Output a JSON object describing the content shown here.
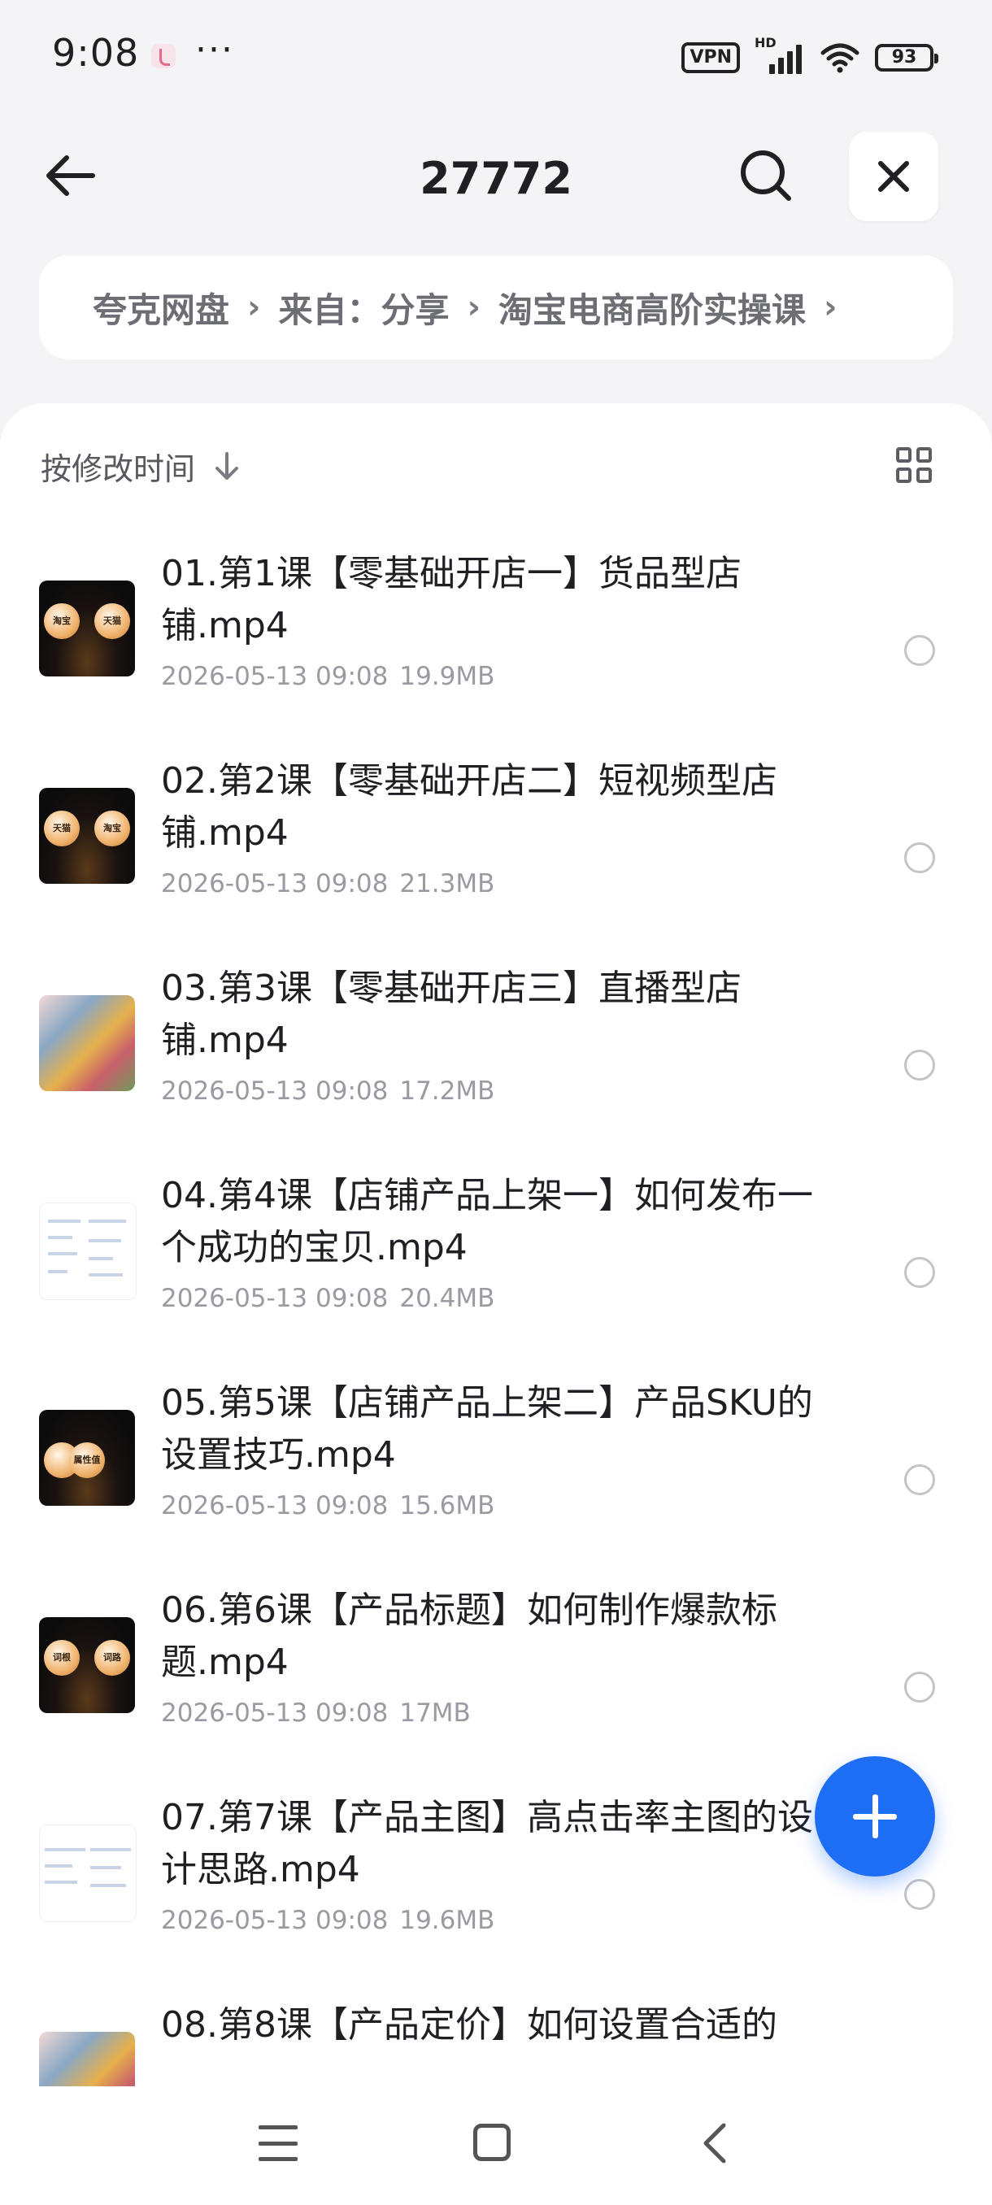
{
  "status_bar": {
    "time": "9:08",
    "overflow": "···",
    "vpn": "VPN",
    "hd": "HD",
    "battery": "93"
  },
  "header": {
    "title": "27772"
  },
  "breadcrumb": [
    "夸克网盘",
    "来自：分享",
    "淘宝电商高阶实操课"
  ],
  "breadcrumb_separator": "›",
  "sort": {
    "label": "按修改时间"
  },
  "files": [
    {
      "name": "01.第1课【零基础开店一】货品型店铺.mp4",
      "date": "2026-05-13 09:08",
      "size": "19.9MB",
      "thumb": "dark",
      "t1": "淘宝",
      "t2": "天猫"
    },
    {
      "name": "02.第2课【零基础开店二】短视频型店铺.mp4",
      "date": "2026-05-13 09:08",
      "size": "21.3MB",
      "thumb": "dark",
      "t1": "天猫",
      "t2": "淘宝"
    },
    {
      "name": "03.第3课【零基础开店三】直播型店铺.mp4",
      "date": "2026-05-13 09:08",
      "size": "17.2MB",
      "thumb": "photo"
    },
    {
      "name": "04.第4课【店铺产品上架一】如何发布一个成功的宝贝.mp4",
      "date": "2026-05-13 09:08",
      "size": "20.4MB",
      "thumb": "doc"
    },
    {
      "name": "05.第5课【店铺产品上架二】产品SKU的设置技巧.mp4",
      "date": "2026-05-13 09:08",
      "size": "15.6MB",
      "thumb": "dark",
      "t1": "",
      "t2": "属性值"
    },
    {
      "name": "06.第6课【产品标题】如何制作爆款标题.mp4",
      "date": "2026-05-13 09:08",
      "size": "17MB",
      "thumb": "dark",
      "t1": "词根",
      "t2": "词路"
    },
    {
      "name": "07.第7课【产品主图】高点击率主图的设计思路.mp4",
      "date": "2026-05-13 09:08",
      "size": "19.6MB",
      "thumb": "doc"
    },
    {
      "name": "08.第8课【产品定价】如何设置合适的",
      "date": "",
      "size": "",
      "thumb": "photo"
    }
  ],
  "colors": {
    "accent": "#1e6ef5",
    "background": "#f4f4f6"
  },
  "icons": {
    "back": "arrow-left-icon",
    "search": "search-icon",
    "close": "close-icon",
    "sort": "arrow-down-icon",
    "grid": "grid-view-icon",
    "fab": "plus-icon"
  }
}
